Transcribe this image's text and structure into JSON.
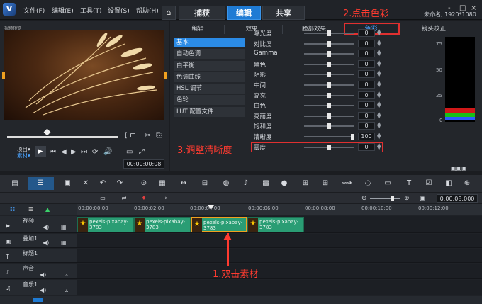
{
  "app": {
    "logo": "V",
    "menus": [
      "文件(F)",
      "编辑(E)",
      "工具(T)",
      "设置(S)",
      "帮助(H)"
    ],
    "main_tabs": [
      "捕获",
      "编辑",
      "共享"
    ],
    "active_tab": "编辑",
    "project_info": "未命名, 1920*1080",
    "win_controls": [
      "-",
      "□",
      "×"
    ]
  },
  "annotations": {
    "step1": "1.双击素材",
    "step2": "2.点击色彩",
    "step3": "3.调整清晰度"
  },
  "preview": {
    "mode_label": "项目▾",
    "mode_label2": "素材▾",
    "timecode": "00:00:00:08",
    "small_label": "视频预览"
  },
  "right_panel": {
    "sub_tabs": [
      "编辑",
      "效果",
      "脸部效果",
      "色彩",
      "镜头校正"
    ],
    "active_sub_tab": "色彩",
    "categories": [
      "基本",
      "自动色调",
      "白平衡",
      "色调曲线",
      "HSL 调节",
      "色轮",
      "LUT 配置文件"
    ],
    "selected_category": "基本",
    "adjustments": [
      {
        "label": "曝光度",
        "value": "0"
      },
      {
        "label": "对比度",
        "value": "0"
      },
      {
        "label": "Gamma",
        "value": "0"
      },
      {
        "label": "黑色",
        "value": "0"
      },
      {
        "label": "阴影",
        "value": "0"
      },
      {
        "label": "中间",
        "value": "0"
      },
      {
        "label": "高亮",
        "value": "0"
      },
      {
        "label": "白色",
        "value": "0"
      },
      {
        "label": "亮丽度",
        "value": "0"
      },
      {
        "label": "饱和度",
        "value": "0"
      },
      {
        "label": "清晰度",
        "value": "100"
      },
      {
        "label": "雾度",
        "value": "0"
      }
    ],
    "histogram_axis": [
      "75",
      "50",
      "25",
      "0"
    ]
  },
  "timeline": {
    "ruler_ticks": [
      "00:00:00:00",
      "00:00:02:00",
      "00:00:04:00",
      "00:00:06:00",
      "00:00:08:00",
      "00:00:10:00",
      "00:00:12:00"
    ],
    "zoom_timecode": "0:00:08:000",
    "tracks": [
      "视频",
      "叠加1",
      "标题1",
      "声音",
      "音乐1"
    ],
    "clips": [
      {
        "label": "pexels-pixabay-3783"
      },
      {
        "label": "pexels-pixabay-3783"
      },
      {
        "label": "pexels-pixabay-3783"
      },
      {
        "label": "pexels-pixabay-3783"
      }
    ]
  }
}
